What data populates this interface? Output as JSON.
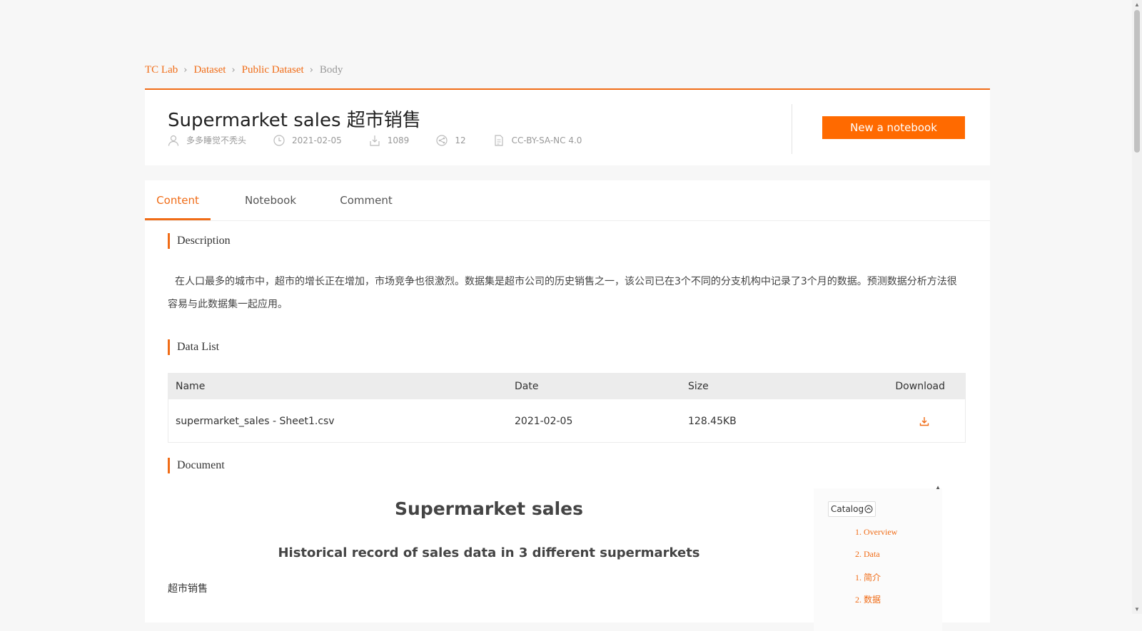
{
  "breadcrumb": {
    "items": [
      "TC Lab",
      "Dataset",
      "Public Dataset",
      "Body"
    ]
  },
  "header": {
    "title": "Supermarket sales 超市销售",
    "author": "多多睡觉不秃头",
    "date": "2021-02-05",
    "downloads": "1089",
    "shares": "12",
    "license": "CC-BY-SA-NC 4.0",
    "new_notebook_label": "New a notebook"
  },
  "tabs": [
    "Content",
    "Notebook",
    "Comment"
  ],
  "sections": {
    "description_title": "Description",
    "description_text": "在人口最多的城市中，超市的增长正在增加，市场竞争也很激烈。数据集是超市公司的历史销售之一，该公司已在3个不同的分支机构中记录了3个月的数据。预测数据分析方法很容易与此数据集一起应用。",
    "data_list_title": "Data List",
    "document_title": "Document"
  },
  "table": {
    "columns": [
      "Name",
      "Date",
      "Size",
      "Download"
    ],
    "rows": [
      {
        "name": "supermarket_sales - Sheet1.csv",
        "date": "2021-02-05",
        "size": "128.45KB"
      }
    ]
  },
  "document": {
    "h1": "Supermarket sales",
    "h2": "Historical record of sales data in 3 different supermarkets",
    "p": "超市销售"
  },
  "catalog": {
    "label": "Catalog",
    "entries": [
      "1. Overview",
      "2. Data",
      "1. 简介",
      "2. 数据"
    ]
  },
  "colors": {
    "accent": "#f06c17",
    "button": "#ff6a00"
  }
}
